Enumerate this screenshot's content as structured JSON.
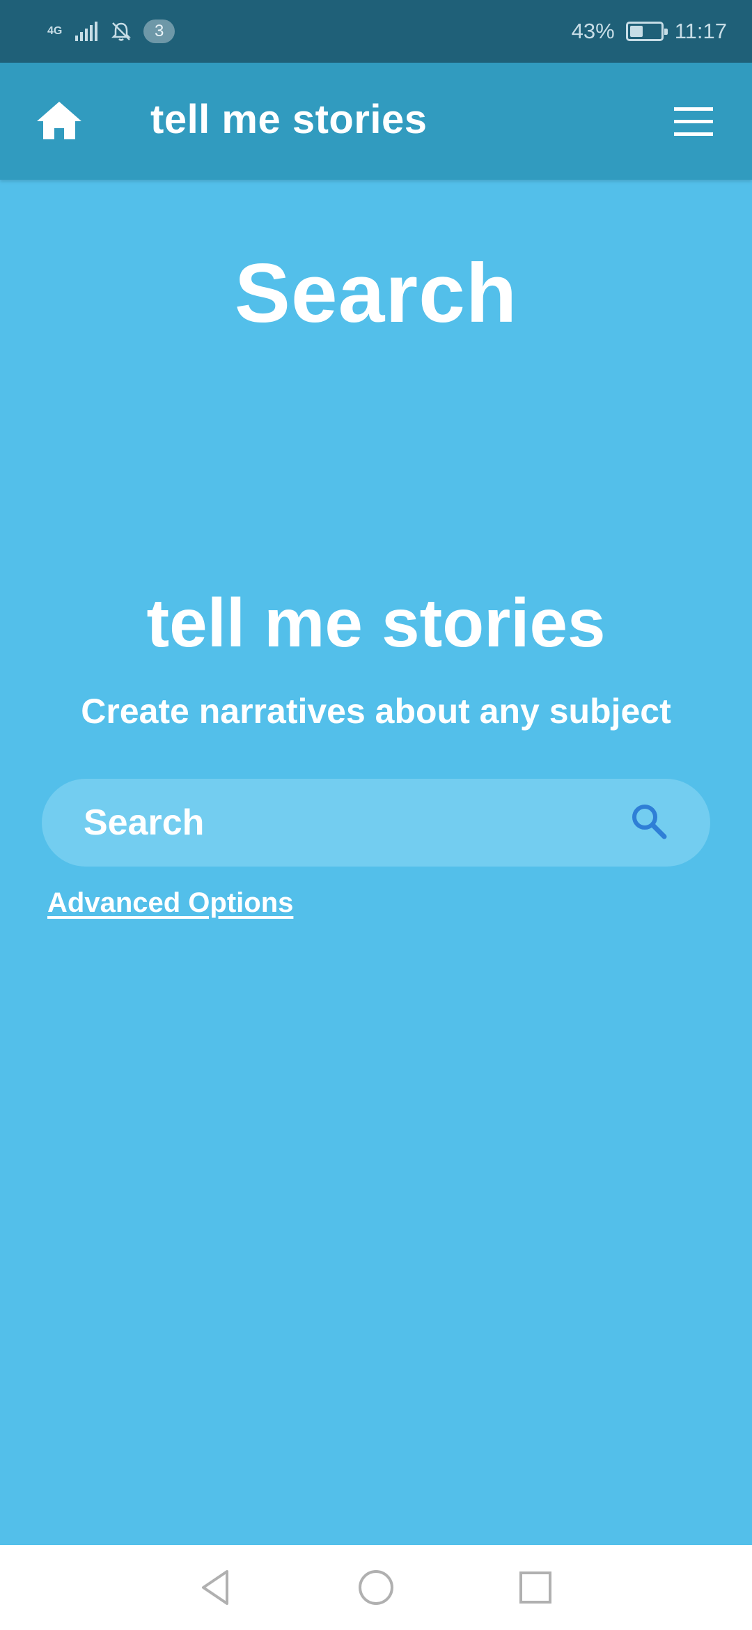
{
  "status_bar": {
    "network": "4G",
    "notification_count": "3",
    "battery_percent": "43%",
    "battery_level": 0.43,
    "time": "11:17"
  },
  "app_bar": {
    "title": "tell me stories",
    "home_icon": "home-icon",
    "menu_icon": "hamburger-menu-icon"
  },
  "main": {
    "page_title": "Search",
    "hero_title": "tell me stories",
    "tagline": "Create narratives about any subject",
    "search": {
      "placeholder": "Search",
      "value": "",
      "icon": "search-icon"
    },
    "advanced_options_label": "Advanced Options"
  },
  "nav_bar": {
    "back_icon": "back-triangle-icon",
    "home_icon": "home-circle-icon",
    "recents_icon": "recents-square-icon"
  },
  "colors": {
    "status_bar_bg": "#1f6078",
    "app_bar_bg": "#319bbf",
    "page_bg": "#53bfea",
    "search_bg": "#73cdf0",
    "search_icon": "#2f7fd6"
  }
}
